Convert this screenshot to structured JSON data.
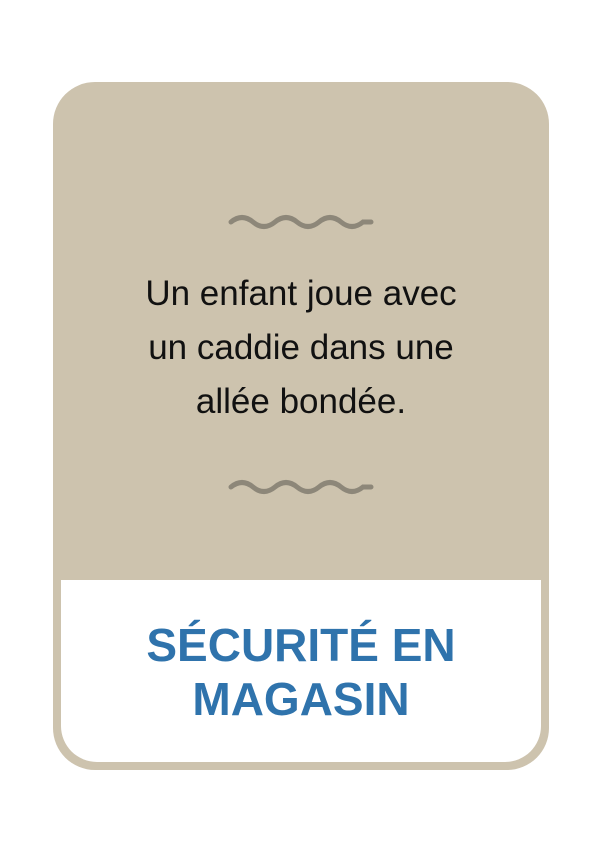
{
  "card": {
    "scenario_text": "Un enfant joue avec\nun caddie dans une\nallée bondée.",
    "category": "SÉCURITÉ EN\nMAGASIN",
    "top_ornament_icon": "wavy-line-icon",
    "bottom_ornament_icon": "wavy-line-icon"
  },
  "colors": {
    "card_background": "#cdc3ae",
    "ornament": "#8d8779",
    "scenario_text": "#111111",
    "category_text": "#2f73ac",
    "footer_background": "#ffffff"
  }
}
